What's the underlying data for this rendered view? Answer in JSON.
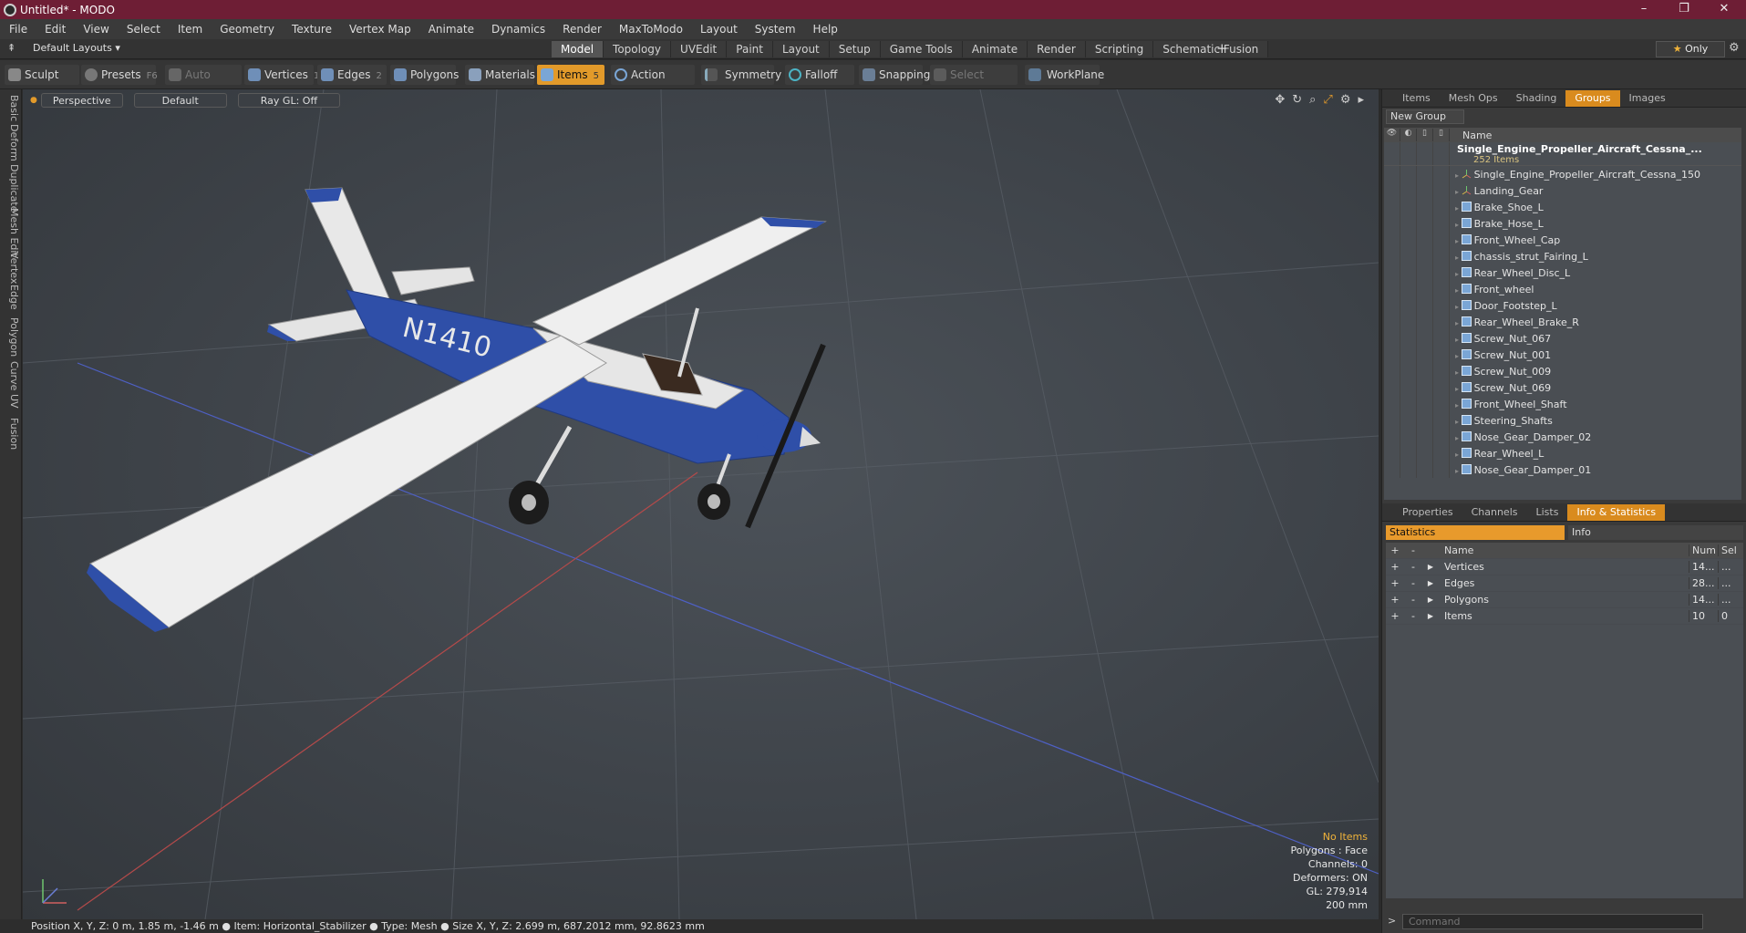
{
  "window": {
    "title": "Untitled* - MODO"
  },
  "menu": [
    "File",
    "Edit",
    "View",
    "Select",
    "Item",
    "Geometry",
    "Texture",
    "Vertex Map",
    "Animate",
    "Dynamics",
    "Render",
    "MaxToModo",
    "Layout",
    "System",
    "Help"
  ],
  "layout_selector": "Default Layouts",
  "layout_tabs": [
    "Model",
    "Topology",
    "UVEdit",
    "Paint",
    "Layout",
    "Setup",
    "Game Tools",
    "Animate",
    "Render",
    "Scripting",
    "Schematic Fusion"
  ],
  "only_button": "Only",
  "toolbar": {
    "sculpt": "Sculpt",
    "presets": "Presets",
    "presets_key": "F6",
    "auto_select": "Auto Select",
    "vertices": "Vertices",
    "vertices_key": "1",
    "edges": "Edges",
    "edges_key": "2",
    "polygons": "Polygons",
    "materials": "Materials",
    "items": "Items",
    "items_key": "5",
    "action_center": "Action Center",
    "symmetry": "Symmetry",
    "falloff": "Falloff",
    "snapping": "Snapping",
    "select_through": "Select Through",
    "workplane": "WorkPlane"
  },
  "left_tabs": [
    "Basic",
    "Deform",
    "Duplicate",
    "Mesh Edit",
    "Vertex",
    "Edge",
    "Polygon",
    "Curve",
    "UV",
    "Fusion"
  ],
  "viewport": {
    "view": "Perspective",
    "shading": "Default",
    "raygl": "Ray GL: Off",
    "tail_number": "N1410",
    "info": {
      "no_items": "No Items",
      "polygons": "Polygons : Face",
      "channels": "Channels: 0",
      "deformers": "Deformers: ON",
      "gl": "GL: 279,914",
      "scale": "200 mm"
    }
  },
  "colors": {
    "titlebar": "#6e1e35",
    "accent": "#e29a2a",
    "plane_blue": "#2f4fa8"
  },
  "statusbar": "Position X, Y, Z:  0 m, 1.85 m, -1.46 m ● Item:  Horizontal_Stabilizer ● Type:  Mesh ● Size X, Y, Z:   2.699 m, 687.2012 mm, 92.8623 mm",
  "upper_panel": {
    "tabs": [
      "Items",
      "Mesh Ops",
      "Shading",
      "Groups",
      "Images"
    ],
    "active_tab": "Groups",
    "new_group": "New Group",
    "column_name": "Name",
    "group": {
      "name": "Single_Engine_Propeller_Aircraft_Cessna_...",
      "count": "252 Items"
    },
    "items": [
      {
        "name": "Single_Engine_Propeller_Aircraft_Cessna_150",
        "type": "locator"
      },
      {
        "name": "Landing_Gear",
        "type": "locator"
      },
      {
        "name": "Brake_Shoe_L",
        "type": "mesh"
      },
      {
        "name": "Brake_Hose_L",
        "type": "mesh"
      },
      {
        "name": "Front_Wheel_Cap",
        "type": "mesh"
      },
      {
        "name": "chassis_strut_Fairing_L",
        "type": "mesh"
      },
      {
        "name": "Rear_Wheel_Disc_L",
        "type": "mesh"
      },
      {
        "name": "Front_wheel",
        "type": "mesh"
      },
      {
        "name": "Door_Footstep_L",
        "type": "mesh"
      },
      {
        "name": "Rear_Wheel_Brake_R",
        "type": "mesh"
      },
      {
        "name": "Screw_Nut_067",
        "type": "mesh"
      },
      {
        "name": "Screw_Nut_001",
        "type": "mesh"
      },
      {
        "name": "Screw_Nut_009",
        "type": "mesh"
      },
      {
        "name": "Screw_Nut_069",
        "type": "mesh"
      },
      {
        "name": "Front_Wheel_Shaft",
        "type": "mesh"
      },
      {
        "name": "Steering_Shafts",
        "type": "mesh"
      },
      {
        "name": "Nose_Gear_Damper_02",
        "type": "mesh"
      },
      {
        "name": "Rear_Wheel_L",
        "type": "mesh"
      },
      {
        "name": "Nose_Gear_Damper_01",
        "type": "mesh"
      }
    ]
  },
  "lower_panel": {
    "tabs": [
      "Properties",
      "Channels",
      "Lists",
      "Info & Statistics"
    ],
    "active_tab": "Info & Statistics",
    "stat_tabs": [
      "Statistics",
      "Info"
    ],
    "headers": {
      "name": "Name",
      "num": "Num",
      "sel": "Sel"
    },
    "rows": [
      {
        "name": "Vertices",
        "num": "14...",
        "sel": "..."
      },
      {
        "name": "Edges",
        "num": "28...",
        "sel": "..."
      },
      {
        "name": "Polygons",
        "num": "14...",
        "sel": "..."
      },
      {
        "name": "Items",
        "num": "10",
        "sel": "0"
      }
    ],
    "command_placeholder": "Command"
  }
}
